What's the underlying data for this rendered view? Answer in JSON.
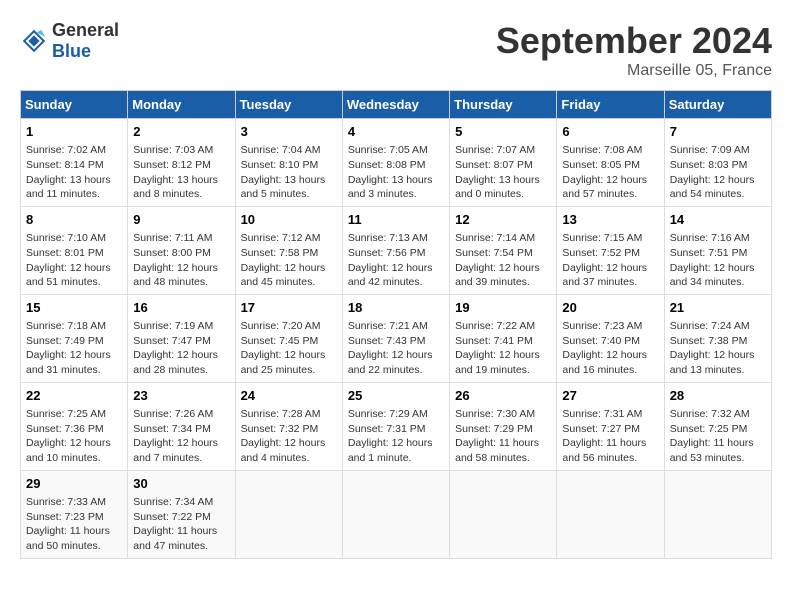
{
  "header": {
    "logo_general": "General",
    "logo_blue": "Blue",
    "month_title": "September 2024",
    "location": "Marseille 05, France"
  },
  "weekdays": [
    "Sunday",
    "Monday",
    "Tuesday",
    "Wednesday",
    "Thursday",
    "Friday",
    "Saturday"
  ],
  "weeks": [
    [
      {
        "day": "1",
        "sunrise": "7:02 AM",
        "sunset": "8:14 PM",
        "daylight": "13 hours and 11 minutes."
      },
      {
        "day": "2",
        "sunrise": "7:03 AM",
        "sunset": "8:12 PM",
        "daylight": "13 hours and 8 minutes."
      },
      {
        "day": "3",
        "sunrise": "7:04 AM",
        "sunset": "8:10 PM",
        "daylight": "13 hours and 5 minutes."
      },
      {
        "day": "4",
        "sunrise": "7:05 AM",
        "sunset": "8:08 PM",
        "daylight": "13 hours and 3 minutes."
      },
      {
        "day": "5",
        "sunrise": "7:07 AM",
        "sunset": "8:07 PM",
        "daylight": "13 hours and 0 minutes."
      },
      {
        "day": "6",
        "sunrise": "7:08 AM",
        "sunset": "8:05 PM",
        "daylight": "12 hours and 57 minutes."
      },
      {
        "day": "7",
        "sunrise": "7:09 AM",
        "sunset": "8:03 PM",
        "daylight": "12 hours and 54 minutes."
      }
    ],
    [
      {
        "day": "8",
        "sunrise": "7:10 AM",
        "sunset": "8:01 PM",
        "daylight": "12 hours and 51 minutes."
      },
      {
        "day": "9",
        "sunrise": "7:11 AM",
        "sunset": "8:00 PM",
        "daylight": "12 hours and 48 minutes."
      },
      {
        "day": "10",
        "sunrise": "7:12 AM",
        "sunset": "7:58 PM",
        "daylight": "12 hours and 45 minutes."
      },
      {
        "day": "11",
        "sunrise": "7:13 AM",
        "sunset": "7:56 PM",
        "daylight": "12 hours and 42 minutes."
      },
      {
        "day": "12",
        "sunrise": "7:14 AM",
        "sunset": "7:54 PM",
        "daylight": "12 hours and 39 minutes."
      },
      {
        "day": "13",
        "sunrise": "7:15 AM",
        "sunset": "7:52 PM",
        "daylight": "12 hours and 37 minutes."
      },
      {
        "day": "14",
        "sunrise": "7:16 AM",
        "sunset": "7:51 PM",
        "daylight": "12 hours and 34 minutes."
      }
    ],
    [
      {
        "day": "15",
        "sunrise": "7:18 AM",
        "sunset": "7:49 PM",
        "daylight": "12 hours and 31 minutes."
      },
      {
        "day": "16",
        "sunrise": "7:19 AM",
        "sunset": "7:47 PM",
        "daylight": "12 hours and 28 minutes."
      },
      {
        "day": "17",
        "sunrise": "7:20 AM",
        "sunset": "7:45 PM",
        "daylight": "12 hours and 25 minutes."
      },
      {
        "day": "18",
        "sunrise": "7:21 AM",
        "sunset": "7:43 PM",
        "daylight": "12 hours and 22 minutes."
      },
      {
        "day": "19",
        "sunrise": "7:22 AM",
        "sunset": "7:41 PM",
        "daylight": "12 hours and 19 minutes."
      },
      {
        "day": "20",
        "sunrise": "7:23 AM",
        "sunset": "7:40 PM",
        "daylight": "12 hours and 16 minutes."
      },
      {
        "day": "21",
        "sunrise": "7:24 AM",
        "sunset": "7:38 PM",
        "daylight": "12 hours and 13 minutes."
      }
    ],
    [
      {
        "day": "22",
        "sunrise": "7:25 AM",
        "sunset": "7:36 PM",
        "daylight": "12 hours and 10 minutes."
      },
      {
        "day": "23",
        "sunrise": "7:26 AM",
        "sunset": "7:34 PM",
        "daylight": "12 hours and 7 minutes."
      },
      {
        "day": "24",
        "sunrise": "7:28 AM",
        "sunset": "7:32 PM",
        "daylight": "12 hours and 4 minutes."
      },
      {
        "day": "25",
        "sunrise": "7:29 AM",
        "sunset": "7:31 PM",
        "daylight": "12 hours and 1 minute."
      },
      {
        "day": "26",
        "sunrise": "7:30 AM",
        "sunset": "7:29 PM",
        "daylight": "11 hours and 58 minutes."
      },
      {
        "day": "27",
        "sunrise": "7:31 AM",
        "sunset": "7:27 PM",
        "daylight": "11 hours and 56 minutes."
      },
      {
        "day": "28",
        "sunrise": "7:32 AM",
        "sunset": "7:25 PM",
        "daylight": "11 hours and 53 minutes."
      }
    ],
    [
      {
        "day": "29",
        "sunrise": "7:33 AM",
        "sunset": "7:23 PM",
        "daylight": "11 hours and 50 minutes."
      },
      {
        "day": "30",
        "sunrise": "7:34 AM",
        "sunset": "7:22 PM",
        "daylight": "11 hours and 47 minutes."
      },
      null,
      null,
      null,
      null,
      null
    ]
  ]
}
